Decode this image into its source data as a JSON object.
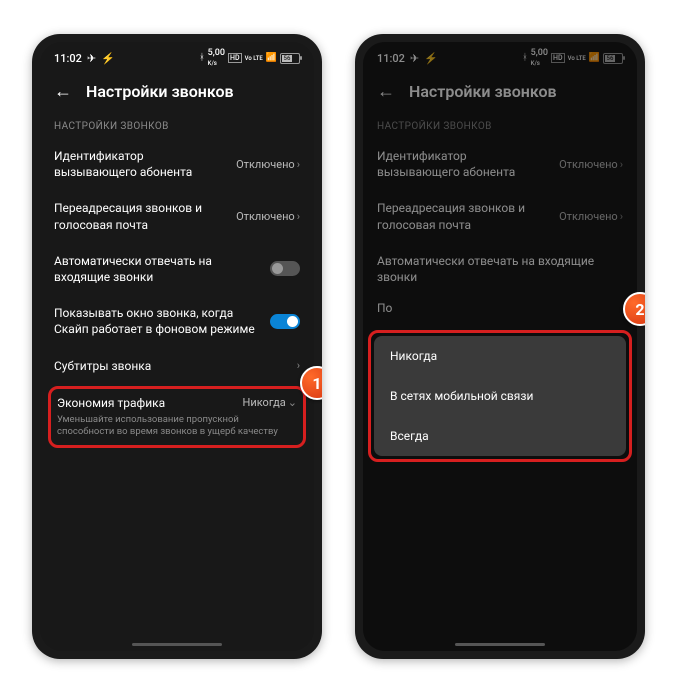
{
  "statusbar": {
    "time": "11:02",
    "bt": "⚡",
    "speed": "5,00",
    "speedUnit": "K/s",
    "hd": "HD",
    "vo": "Vo LTE",
    "sig": "▫",
    "batt": "56"
  },
  "header": {
    "title": "Настройки звонков"
  },
  "section": "НАСТРОЙКИ ЗВОНКОВ",
  "rows": {
    "callerId": {
      "title": "Идентификатор вызывающего абонента",
      "value": "Отключено"
    },
    "forward": {
      "title": "Переадресация звонков и голосовая почта",
      "value": "Отключено"
    },
    "autoAnswer": {
      "title": "Автоматически отвечать на входящие звонки"
    },
    "showWindow": {
      "title": "Показывать окно звонка, когда Скайп работает в фоновом режиме"
    },
    "captions": {
      "title": "Субтитры звонка"
    },
    "saveData": {
      "title": "Экономия трафика",
      "value": "Никогда",
      "sub": "Уменьшайте использование пропускной способности во время звонков в ущерб качеству"
    }
  },
  "popup": {
    "opt1": "Никогда",
    "opt2": "В сетях мобильной связи",
    "opt3": "Всегда"
  },
  "badges": {
    "one": "1",
    "two": "2"
  }
}
